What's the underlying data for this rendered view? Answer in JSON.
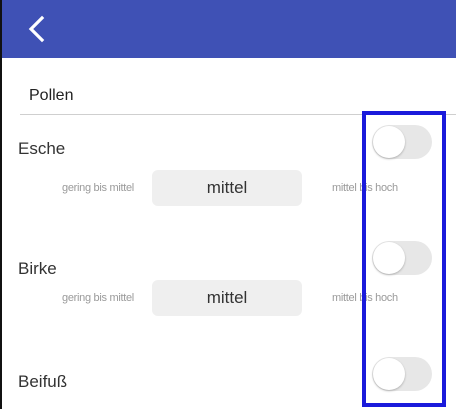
{
  "header": {
    "back_icon": "chevron-left-icon",
    "color": "#3f51b5"
  },
  "section": {
    "title": "Pollen"
  },
  "items": [
    {
      "title": "Esche",
      "low": "gering bis mittel",
      "level": "mittel",
      "high": "mittel bis hoch",
      "enabled": false
    },
    {
      "title": "Birke",
      "low": "gering bis mittel",
      "level": "mittel",
      "high": "mittel bis hoch",
      "enabled": false
    },
    {
      "title": "Beifuß",
      "enabled": false
    }
  ],
  "highlight_color": "#1a1adb"
}
